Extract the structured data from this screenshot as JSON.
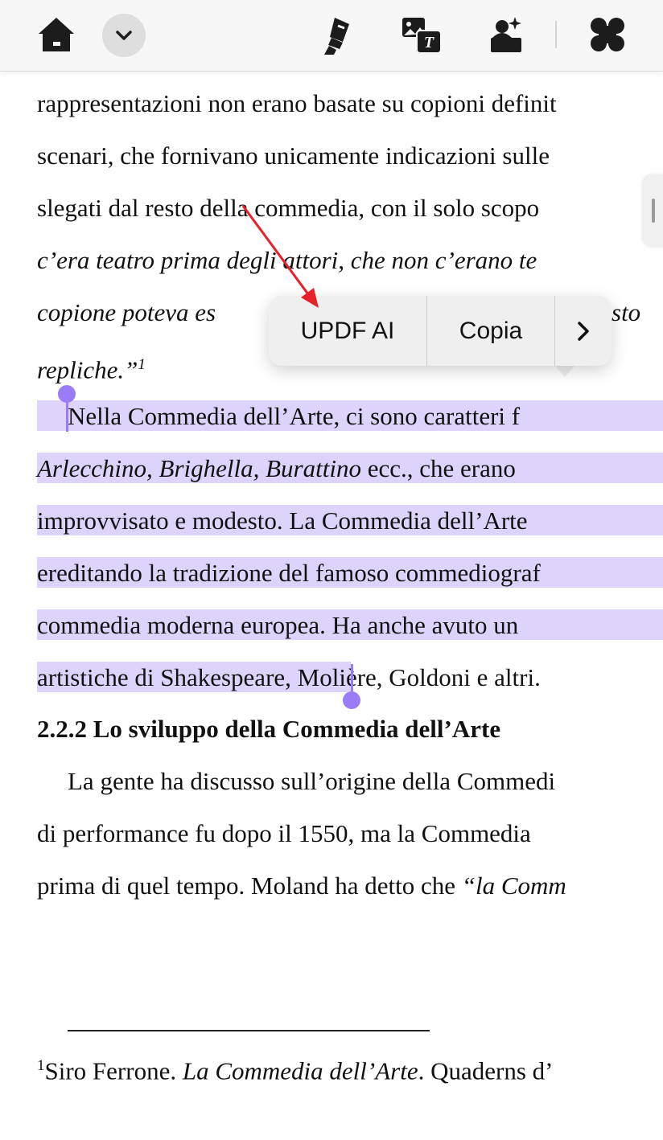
{
  "toolbar": {
    "icons": [
      "home-icon",
      "chevron-down-icon",
      "highlighter-icon",
      "translate-icon",
      "image-ai-icon",
      "apps-grid-icon"
    ]
  },
  "document": {
    "lines": [
      "rappresentazioni non erano basate su copioni definit",
      "scenari, che fornivano unicamente indicazioni sulle",
      "slegati dal resto della commedia, con il solo scopo",
      "c’era teatro prima degli attori, che non c’erano te",
      "copione poteva es",
      "sto",
      "repliche.”",
      "1",
      "Nella Commedia dell’Arte, ci sono caratteri f",
      "Arlecchino, Brighella, Burattino",
      " ecc., che erano",
      "improvvisato e modesto. La Commedia dell’Arte",
      "ereditando la tradizione del famoso commediograf",
      "commedia moderna europea. Ha anche avuto un",
      "artistiche di Shakespeare,",
      " Molière, Goldoni e altri."
    ],
    "heading": "2.2.2 Lo sviluppo della Commedia dell’Arte",
    "after": [
      "La gente ha discusso sull’origine della Commedi",
      "di performance fu dopo il 1550, ma la Commedia",
      "prima di quel tempo. Moland ha detto che ",
      "“la Comm"
    ],
    "footnote": {
      "mark": "1",
      "text1": "Siro Ferrone. ",
      "title": "La Commedia dell’Arte",
      "text2": ". Quaderns d’"
    }
  },
  "context_menu": {
    "ai_label": "UPDF AI",
    "copy_label": "Copia",
    "more_label": "›"
  },
  "colors": {
    "selection": "#ddd3fb",
    "handle": "#9b7cf7",
    "annotation_arrow": "#e8202a"
  }
}
